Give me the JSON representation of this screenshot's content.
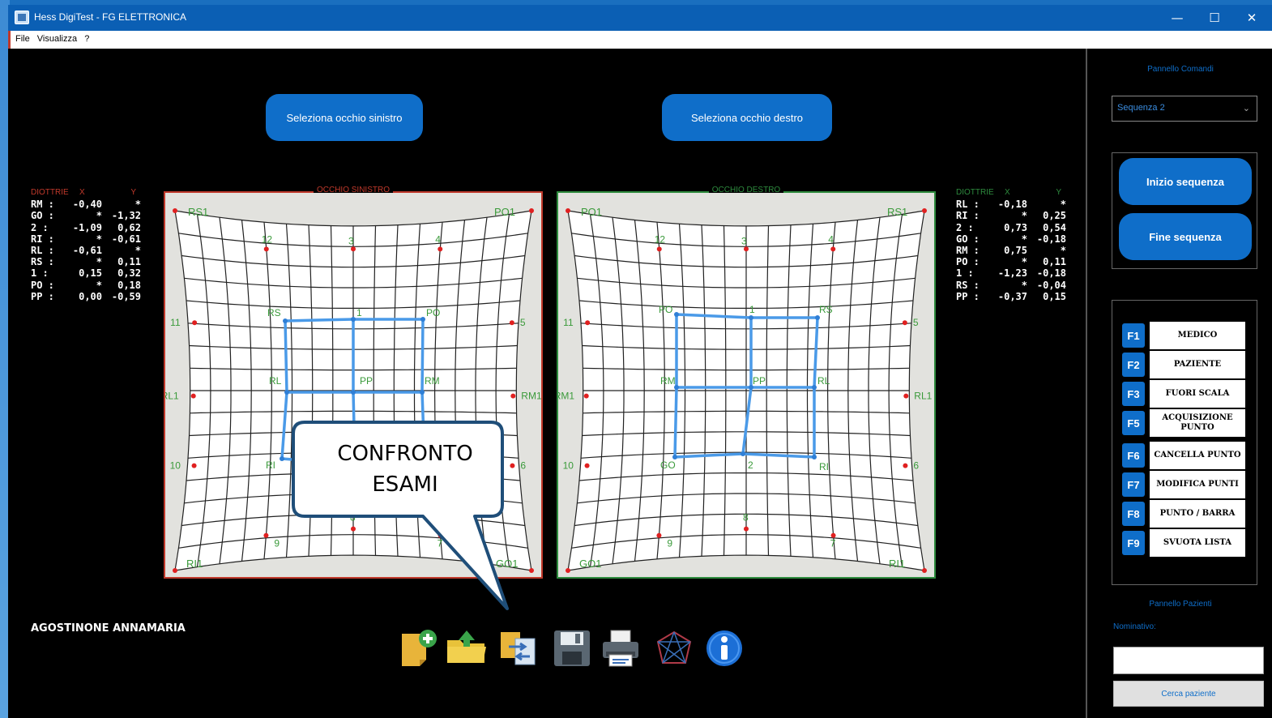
{
  "window": {
    "title": "Hess DigiTest - FG ELETTRONICA",
    "minimize": "—",
    "maximize": "☐",
    "close": "✕"
  },
  "menu": [
    "File",
    "Visualizza",
    "?"
  ],
  "eye_buttons": {
    "left": "Seleziona occhio sinistro",
    "right": "Seleziona occhio destro"
  },
  "left_readout": {
    "header": [
      "DIOTTRIE",
      "X",
      "Y"
    ],
    "rows": [
      [
        "RM :",
        "-0,40",
        "*"
      ],
      [
        "GO :",
        "*",
        "-1,32"
      ],
      [
        "2 :",
        "-1,09",
        "0,62"
      ],
      [
        "RI :",
        "*",
        "-0,61"
      ],
      [
        "RL :",
        "-0,61",
        "*"
      ],
      [
        "RS :",
        "*",
        "0,11"
      ],
      [
        "1 :",
        "0,15",
        "0,32"
      ],
      [
        "PO :",
        "*",
        "0,18"
      ],
      [
        "PP :",
        "0,00",
        "-0,59"
      ]
    ]
  },
  "right_readout": {
    "header": [
      "DIOTTRIE",
      "X",
      "Y"
    ],
    "rows": [
      [
        "RL :",
        "-0,18",
        "*"
      ],
      [
        "RI :",
        "*",
        "0,25"
      ],
      [
        "2 :",
        "0,73",
        "0,54"
      ],
      [
        "GO :",
        "*",
        "-0,18"
      ],
      [
        "RM :",
        "0,75",
        "*"
      ],
      [
        "PO :",
        "*",
        "0,11"
      ],
      [
        "1 :",
        "-1,23",
        "-0,18"
      ],
      [
        "RS :",
        "*",
        "-0,04"
      ],
      [
        "PP :",
        "-0,37",
        "0,15"
      ]
    ]
  },
  "charts": {
    "left": {
      "title": "OCCHIO SINISTRO",
      "frame_color": "#c0392b",
      "corner_labels": [
        "RS1",
        "PO1",
        "RI1",
        "GO1"
      ],
      "outer_labels": [
        "12",
        "3",
        "4",
        "11",
        "5",
        "RL1",
        "RM1",
        "10",
        "6",
        "9",
        "8",
        "7"
      ],
      "inner_labels": [
        "RS",
        "1",
        "PO",
        "RL",
        "PP",
        "RM",
        "RI"
      ]
    },
    "right": {
      "title": "OCCHIO DESTRO",
      "frame_color": "#2e8b3e",
      "corner_labels": [
        "PO1",
        "RS1",
        "GO1",
        "RI1"
      ],
      "outer_labels": [
        "12",
        "3",
        "4",
        "11",
        "5",
        "RM1",
        "RL1",
        "10",
        "6",
        "9",
        "8",
        "7"
      ],
      "inner_labels": [
        "PO",
        "1",
        "RS",
        "RM",
        "PP",
        "RL",
        "GO",
        "2",
        "RI"
      ]
    }
  },
  "patient_name": "AGOSTINONE ANNAMARIA",
  "toolbar_icons": [
    "new-exam-icon",
    "open-folder-icon",
    "compare-exams-icon",
    "save-disk-icon",
    "printer-icon",
    "3d-view-icon",
    "info-icon"
  ],
  "callout": {
    "line1": "CONFRONTO",
    "line2": "ESAMI"
  },
  "right_panel": {
    "commands_caption": "Pannello Comandi",
    "sequence_value": "Sequenza 2",
    "start_sequence": "Inizio sequenza",
    "end_sequence": "Fine sequenza",
    "fkeys": [
      {
        "key": "F1",
        "label": "MEDICO"
      },
      {
        "key": "F2",
        "label": "PAZIENTE"
      },
      {
        "key": "F3",
        "label": "FUORI SCALA"
      },
      {
        "key": "F5",
        "label": "ACQUISIZIONE PUNTO"
      },
      {
        "key": "F6",
        "label": "CANCELLA PUNTO"
      },
      {
        "key": "F7",
        "label": "MODIFICA PUNTI"
      },
      {
        "key": "F8",
        "label": "PUNTO / BARRA"
      },
      {
        "key": "F9",
        "label": "SVUOTA LISTA"
      }
    ],
    "patient_caption": "Pannello Pazienti",
    "nominativo_label": "Nominativo:",
    "nominativo_value": "",
    "search_button": "Cerca paziente"
  }
}
